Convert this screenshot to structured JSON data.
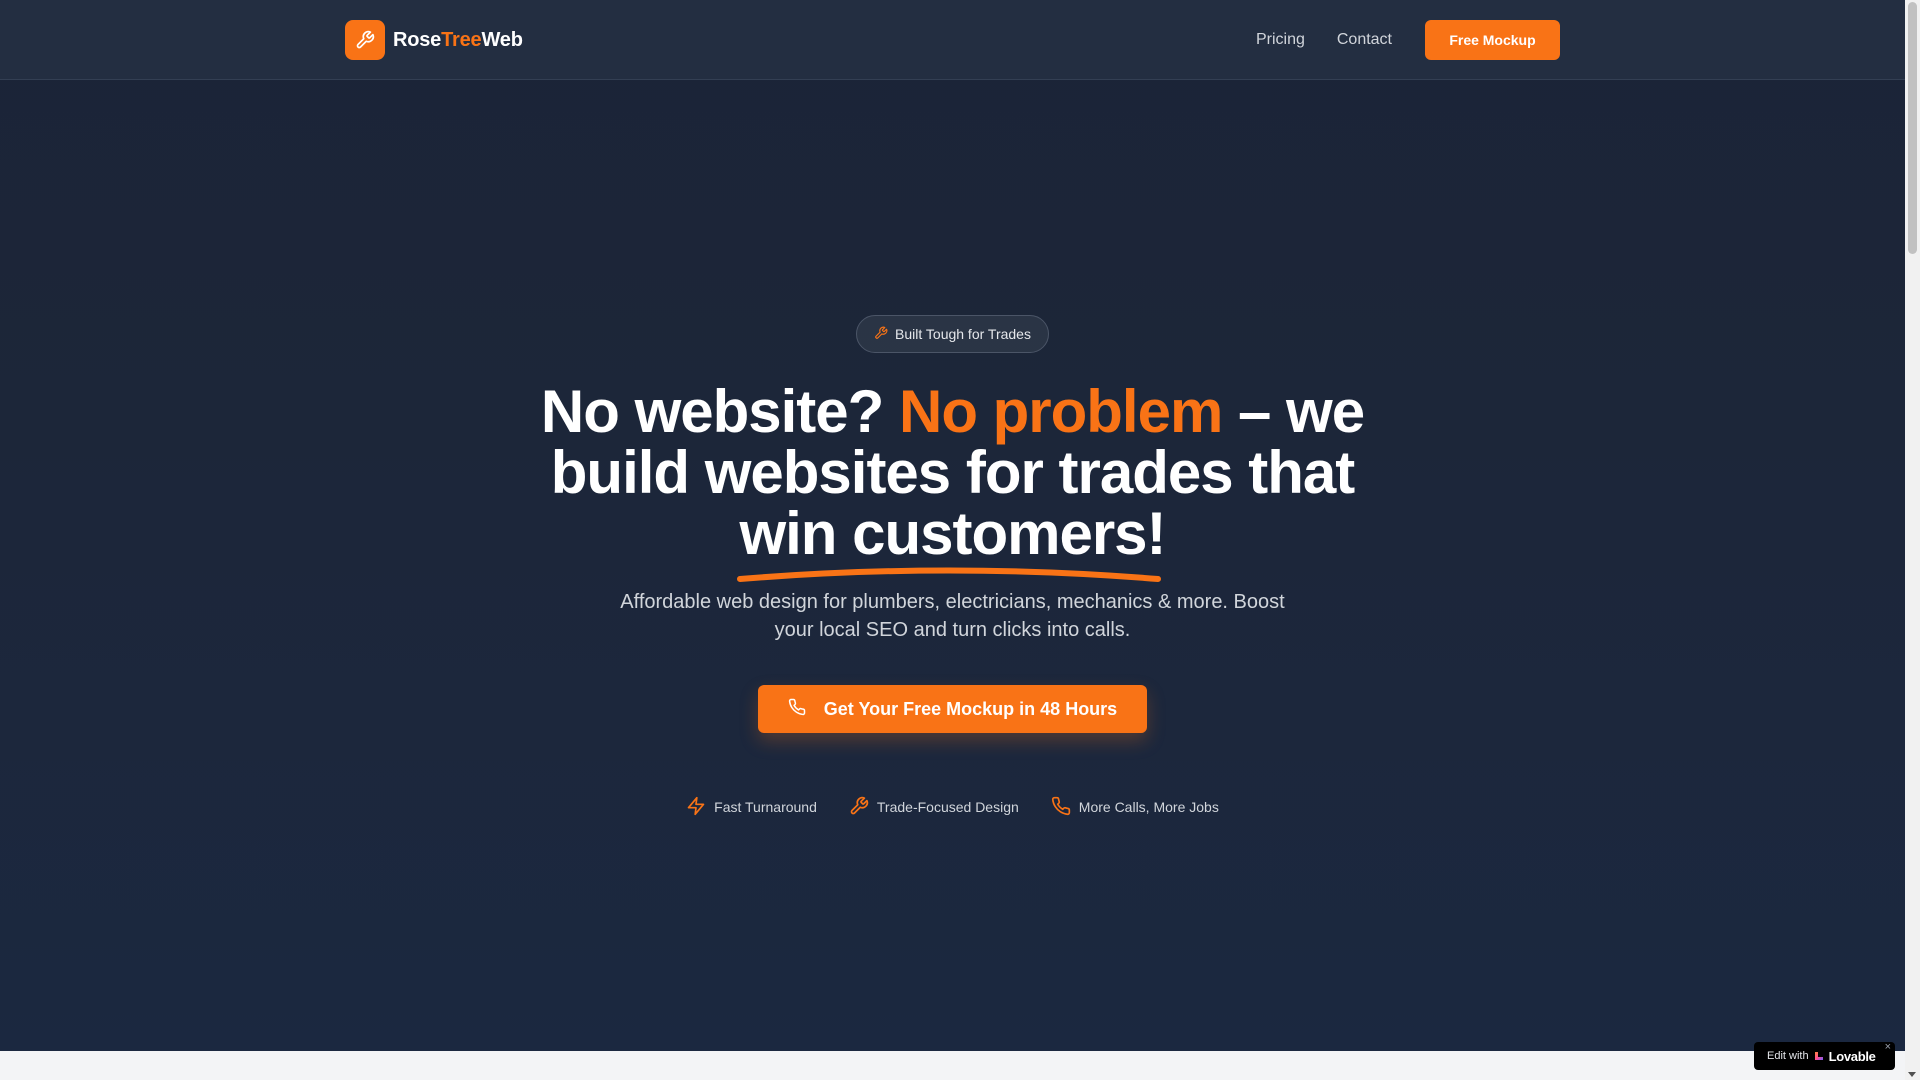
{
  "brand": {
    "name_part1": "Rose",
    "name_part2": "Tree",
    "name_part3": "Web",
    "logo_icon": "wrench-icon",
    "accent_color": "#f97316"
  },
  "nav": {
    "links": [
      "Pricing",
      "Contact"
    ],
    "cta_label": "Free Mockup"
  },
  "hero": {
    "badge_icon": "wrench-icon",
    "badge_text": "Built Tough for Trades",
    "headline_part1": "No website? ",
    "headline_highlight": "No problem",
    "headline_part2": " – we build websites for trades that ",
    "headline_underlined": "win customers!",
    "subtext": "Affordable web design for plumbers, electricians, mechanics & more. Boost your local SEO and turn clicks into calls.",
    "cta_icon": "phone-icon",
    "cta_label": "Get Your Free Mockup in 48 Hours",
    "features": [
      {
        "icon": "lightning-icon",
        "label": "Fast Turnaround"
      },
      {
        "icon": "wrench-icon",
        "label": "Trade-Focused Design"
      },
      {
        "icon": "phone-icon",
        "label": "More Calls, More Jobs"
      }
    ]
  },
  "lovable_badge": {
    "prefix": "Edit with",
    "brand": "Lovable",
    "close": "×"
  }
}
